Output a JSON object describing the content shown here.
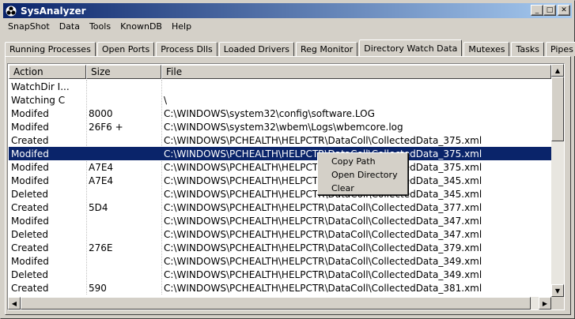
{
  "window": {
    "title": "SysAnalyzer",
    "controls": {
      "minimize": "_",
      "maximize": "□",
      "close": "✕"
    }
  },
  "menu": [
    "SnapShot",
    "Data",
    "Tools",
    "KnownDB",
    "Help"
  ],
  "tabs": [
    {
      "label": "Running Processes",
      "active": false
    },
    {
      "label": "Open Ports",
      "active": false
    },
    {
      "label": "Process Dlls",
      "active": false
    },
    {
      "label": "Loaded Drivers",
      "active": false
    },
    {
      "label": "Reg Monitor",
      "active": false
    },
    {
      "label": "Directory Watch Data",
      "active": true
    },
    {
      "label": "Mutexes",
      "active": false
    },
    {
      "label": "Tasks",
      "active": false
    },
    {
      "label": "Pipes",
      "active": false
    }
  ],
  "list": {
    "columns": [
      "Action",
      "Size",
      "File"
    ],
    "rows": [
      {
        "action": "WatchDir I...",
        "size": "",
        "file": ""
      },
      {
        "action": "Watching C",
        "size": "",
        "file": "\\"
      },
      {
        "action": "Modifed",
        "size": "8000",
        "file": "C:\\WINDOWS\\system32\\config\\software.LOG"
      },
      {
        "action": "Modifed",
        "size": "26F6 +",
        "file": "C:\\WINDOWS\\system32\\wbem\\Logs\\wbemcore.log"
      },
      {
        "action": "Created",
        "size": "",
        "file": "C:\\WINDOWS\\PCHEALTH\\HELPCTR\\DataColl\\CollectedData_375.xml"
      },
      {
        "action": "Modifed",
        "size": "",
        "file": "C:\\WINDOWS\\PCHEALTH\\HELPCTR\\DataColl\\CollectedData_375.xml",
        "selected": true
      },
      {
        "action": "Modifed",
        "size": "A7E4",
        "file": "C:\\WINDOWS\\PCHEALTH\\HELPCTR\\DataColl\\CollectedData_375.xml"
      },
      {
        "action": "Modifed",
        "size": "A7E4",
        "file": "C:\\WINDOWS\\PCHEALTH\\HELPCTR\\DataColl\\CollectedData_345.xml"
      },
      {
        "action": "Deleted",
        "size": "",
        "file": "C:\\WINDOWS\\PCHEALTH\\HELPCTR\\DataColl\\CollectedData_345.xml"
      },
      {
        "action": "Created",
        "size": "5D4",
        "file": "C:\\WINDOWS\\PCHEALTH\\HELPCTR\\DataColl\\CollectedData_377.xml"
      },
      {
        "action": "Modifed",
        "size": "",
        "file": "C:\\WINDOWS\\PCHEALTH\\HELPCTR\\DataColl\\CollectedData_347.xml"
      },
      {
        "action": "Deleted",
        "size": "",
        "file": "C:\\WINDOWS\\PCHEALTH\\HELPCTR\\DataColl\\CollectedData_347.xml"
      },
      {
        "action": "Created",
        "size": "276E",
        "file": "C:\\WINDOWS\\PCHEALTH\\HELPCTR\\DataColl\\CollectedData_379.xml"
      },
      {
        "action": "Modifed",
        "size": "",
        "file": "C:\\WINDOWS\\PCHEALTH\\HELPCTR\\DataColl\\CollectedData_349.xml"
      },
      {
        "action": "Deleted",
        "size": "",
        "file": "C:\\WINDOWS\\PCHEALTH\\HELPCTR\\DataColl\\CollectedData_349.xml"
      },
      {
        "action": "Created",
        "size": "590",
        "file": "C:\\WINDOWS\\PCHEALTH\\HELPCTR\\DataColl\\CollectedData_381.xml"
      }
    ]
  },
  "context_menu": {
    "items": [
      "Copy Path",
      "Open Directory",
      "Clear"
    ]
  },
  "colors": {
    "selection": "#0a246a",
    "titlebar_start": "#0a246a",
    "titlebar_end": "#a6caf0",
    "face": "#d4d0c8"
  },
  "icons": {
    "app": "biohazard-icon",
    "scroll_up": "arrow-up-icon",
    "scroll_down": "arrow-down-icon",
    "scroll_left": "arrow-left-icon",
    "scroll_right": "arrow-right-icon"
  }
}
